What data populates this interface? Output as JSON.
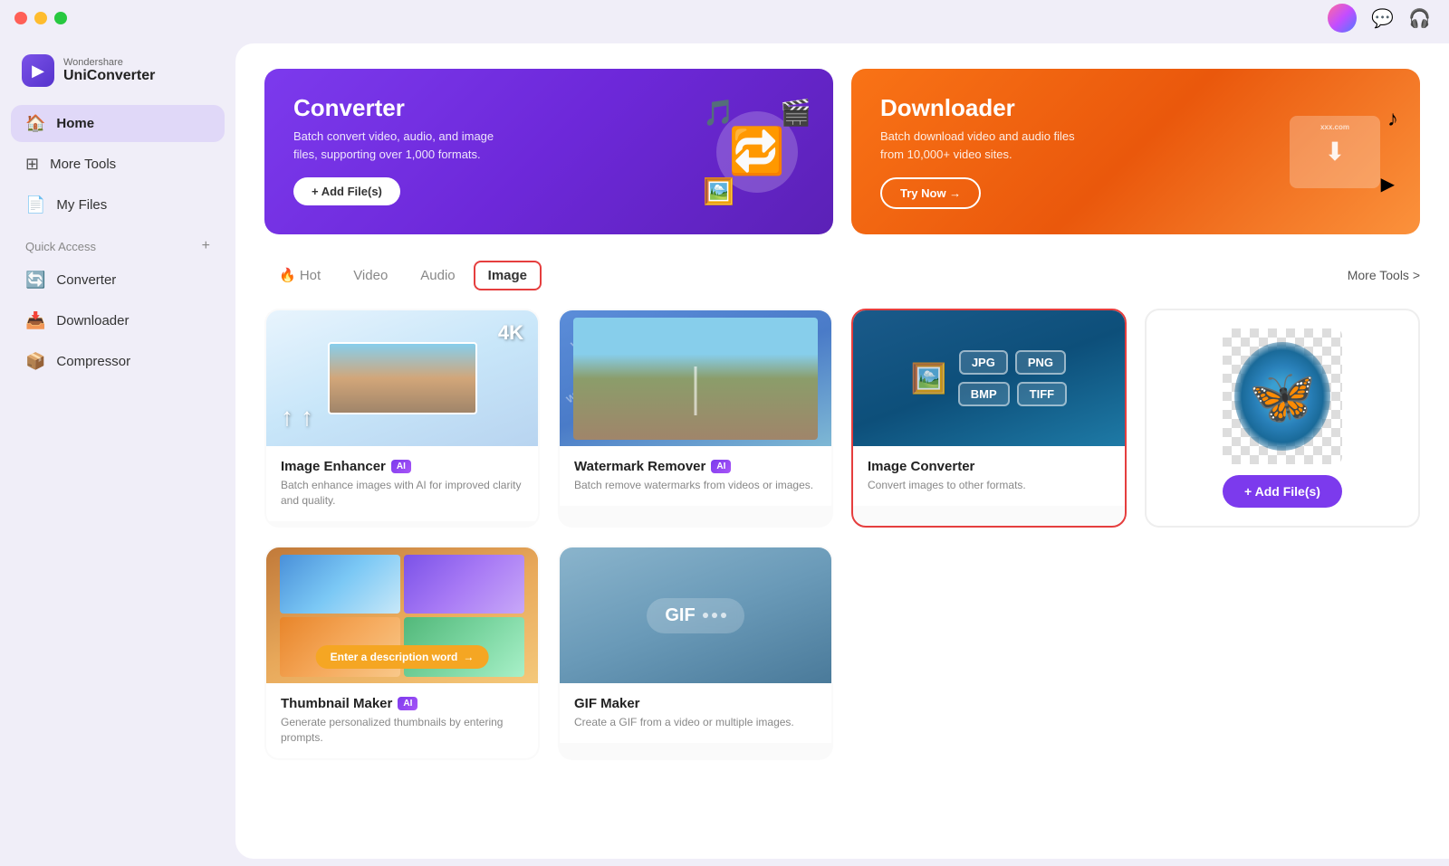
{
  "app": {
    "brand": "Wondershare",
    "name": "UniConverter"
  },
  "titlebar": {
    "buttons": [
      "close",
      "minimize",
      "maximize"
    ]
  },
  "sidebar": {
    "nav": [
      {
        "id": "home",
        "label": "Home",
        "icon": "🏠",
        "active": true
      },
      {
        "id": "more-tools",
        "label": "More Tools",
        "icon": "⊞"
      },
      {
        "id": "my-files",
        "label": "My Files",
        "icon": "📄"
      }
    ],
    "quick_access_label": "Quick Access",
    "quick_access_plus": "+",
    "quick_access_items": [
      {
        "id": "converter",
        "label": "Converter",
        "icon": "🔄"
      },
      {
        "id": "downloader",
        "label": "Downloader",
        "icon": "📥"
      },
      {
        "id": "compressor",
        "label": "Compressor",
        "icon": "📦"
      }
    ]
  },
  "banners": [
    {
      "id": "converter",
      "title": "Converter",
      "desc": "Batch convert video, audio, and image files, supporting over 1,000 formats.",
      "btn_label": "+ Add File(s)",
      "btn_type": "solid"
    },
    {
      "id": "downloader",
      "title": "Downloader",
      "desc": "Batch download video and audio files from 10,000+ video sites.",
      "btn_label": "Try Now →",
      "btn_type": "outline"
    }
  ],
  "tabs": [
    {
      "id": "hot",
      "label": "🔥 Hot",
      "active": false
    },
    {
      "id": "video",
      "label": "Video",
      "active": false
    },
    {
      "id": "audio",
      "label": "Audio",
      "active": false
    },
    {
      "id": "image",
      "label": "Image",
      "active": true
    }
  ],
  "more_tools_link": "More Tools >",
  "tools": [
    {
      "id": "image-enhancer",
      "name": "Image Enhancer",
      "has_ai": true,
      "desc": "Batch enhance images with AI for improved clarity and quality.",
      "thumb_type": "enhancer",
      "selected": false
    },
    {
      "id": "watermark-remover",
      "name": "Watermark Remover",
      "has_ai": true,
      "desc": "Batch remove watermarks from videos or images.",
      "thumb_type": "watermark",
      "selected": false
    },
    {
      "id": "image-converter",
      "name": "Image Converter",
      "has_ai": false,
      "desc": "Convert images to other formats.",
      "thumb_type": "converter",
      "selected": true
    },
    {
      "id": "bg-remover",
      "name": "Add File(s)",
      "has_ai": false,
      "desc": "",
      "thumb_type": "bg-remover",
      "is_add_card": true,
      "selected": false
    },
    {
      "id": "thumbnail-maker",
      "name": "Thumbnail Maker",
      "has_ai": true,
      "desc": "Generate personalized thumbnails by entering prompts.",
      "thumb_type": "thumbnail",
      "selected": false
    },
    {
      "id": "gif-maker",
      "name": "GIF Maker",
      "has_ai": false,
      "desc": "Create a GIF from a video or multiple images.",
      "thumb_type": "gif",
      "selected": false
    }
  ],
  "add_files_btn": "+ Add File(s)",
  "enter_desc_placeholder": "Enter a description word",
  "gif_label": "GIF",
  "format_badges": [
    "JPG",
    "PNG",
    "BMP",
    "TIFF"
  ]
}
